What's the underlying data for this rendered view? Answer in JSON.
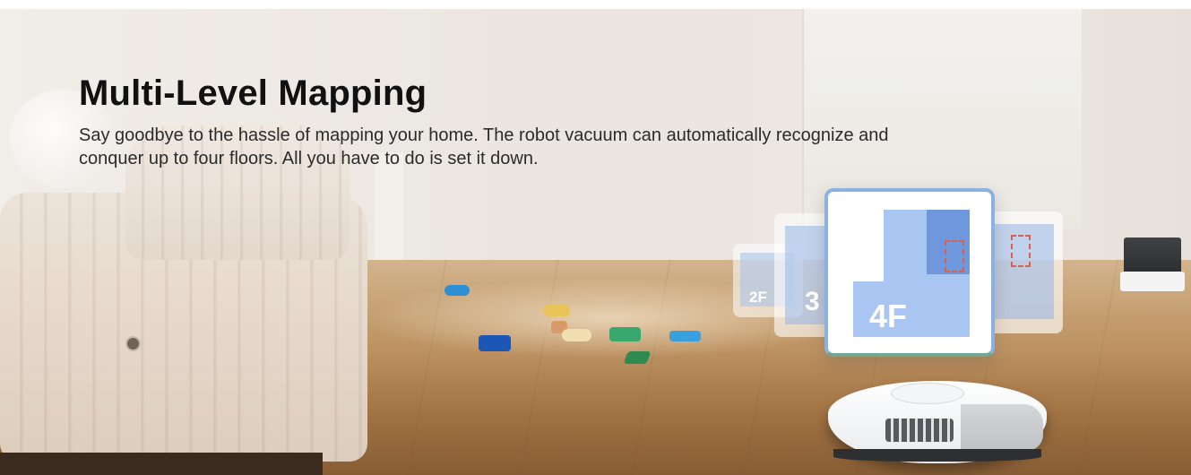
{
  "banner": {
    "headline": "Multi-Level Mapping",
    "description": "Say goodbye to the hassle of mapping your home. The robot vacuum can automatically recognize and conquer up to four floors. All you have to do is set it down."
  },
  "maps": {
    "main_label": "4F",
    "mid_label": "3",
    "small_label": "2F"
  },
  "colors": {
    "map_fill": "#a9c6f2",
    "map_accent": "#6f98dc",
    "map_border": "#8bb1e3",
    "text": "#111111"
  }
}
